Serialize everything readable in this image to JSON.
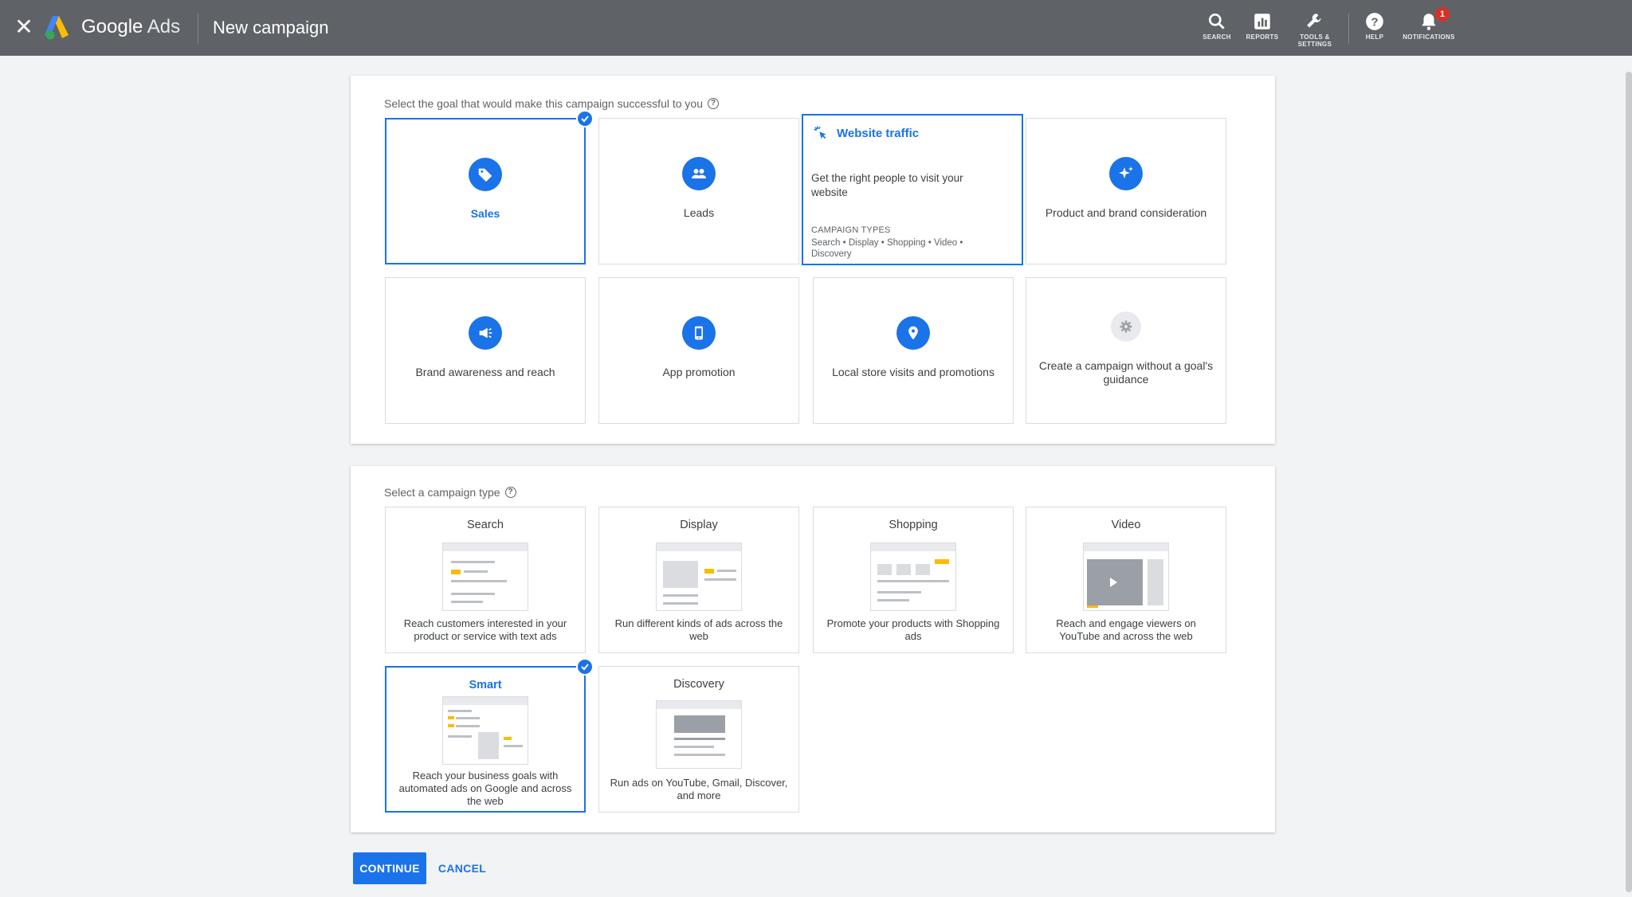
{
  "topbar": {
    "close_glyph": "✕",
    "brand_google": "Google",
    "brand_ads": "Ads",
    "page_title": "New campaign",
    "tools": [
      {
        "label": "SEARCH",
        "icon": "search-icon"
      },
      {
        "label": "REPORTS",
        "icon": "reports-icon"
      },
      {
        "label": "TOOLS &",
        "label2": "SETTINGS",
        "icon": "wrench-icon"
      },
      {
        "label": "HELP",
        "icon": "help-icon"
      },
      {
        "label": "NOTIFICATIONS",
        "icon": "bell-icon",
        "badge": "1"
      }
    ]
  },
  "goal_section": {
    "prompt": "Select the goal that would make this campaign successful to you",
    "goals": [
      {
        "label": "Sales",
        "icon": "tag-icon",
        "selected": true
      },
      {
        "label": "Leads",
        "icon": "people-icon"
      },
      {
        "label": "Website traffic",
        "icon": "cursor-click-icon",
        "description": "Get the right people to visit your website",
        "types_heading": "CAMPAIGN TYPES",
        "types": "Search • Display • Shopping • Video • Discovery"
      },
      {
        "label": "Product and brand consideration",
        "icon": "sparkle-icon"
      },
      {
        "label": "Brand awareness and reach",
        "icon": "megaphone-icon"
      },
      {
        "label": "App promotion",
        "icon": "phone-icon"
      },
      {
        "label": "Local store visits and promotions",
        "icon": "location-pin-icon"
      },
      {
        "label": "Create a campaign without a goal's guidance",
        "icon": "gear-icon"
      }
    ]
  },
  "type_section": {
    "prompt": "Select a campaign type",
    "types": [
      {
        "title": "Search",
        "description": "Reach customers interested in your product or service with text ads"
      },
      {
        "title": "Display",
        "description": "Run different kinds of ads across the web"
      },
      {
        "title": "Shopping",
        "description": "Promote your products with Shopping ads"
      },
      {
        "title": "Video",
        "description": "Reach and engage viewers on YouTube and across the web"
      },
      {
        "title": "Smart",
        "description": "Reach your business goals with automated ads on Google and across the web",
        "selected": true
      },
      {
        "title": "Discovery",
        "description": "Run ads on YouTube, Gmail, Discover, and more"
      }
    ]
  },
  "actions": {
    "continue": "CONTINUE",
    "cancel": "CANCEL"
  },
  "colors": {
    "topbar": "#5f6368",
    "accent": "#1a73e8",
    "badge": "#d93025"
  }
}
